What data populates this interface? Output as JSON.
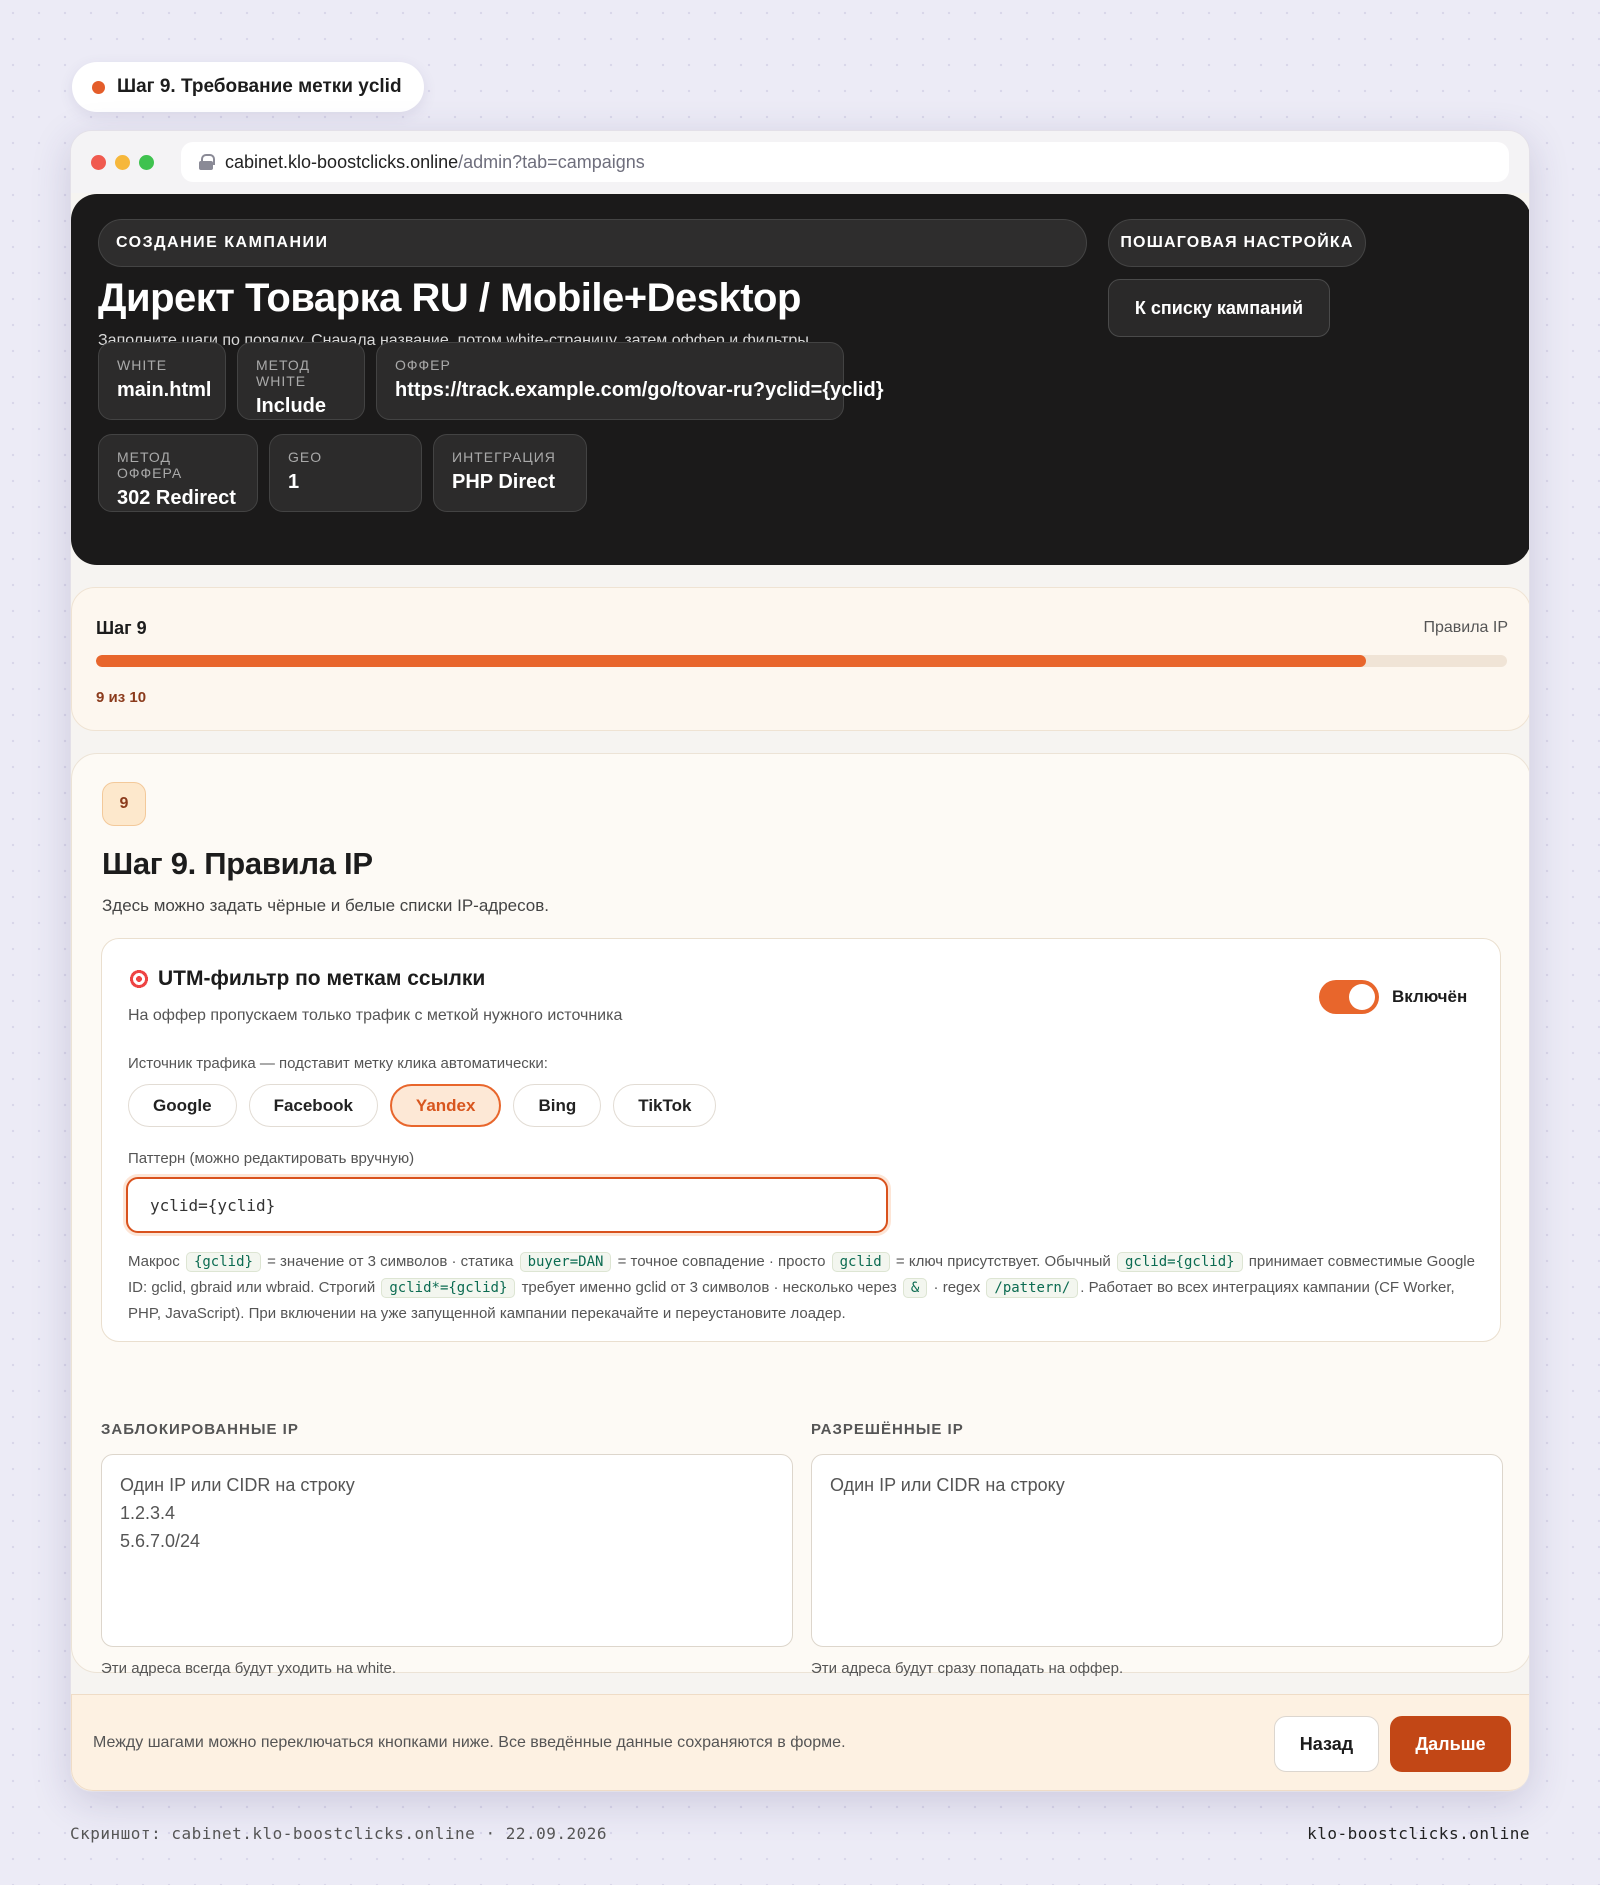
{
  "step_pill": "Шаг 9. Требование метки yclid",
  "browser": {
    "domain": "cabinet.klo-boostclicks.online",
    "path": "/admin?tab=campaigns"
  },
  "hero": {
    "badge": "СОЗДАНИЕ КАМПАНИИ",
    "title": "Директ Товарка RU / Mobile+Desktop",
    "subtitle": "Заполните шаги по порядку. Сначала название, потом white-страницу, затем оффер и фильтры.",
    "right_badge": "ПОШАГОВАЯ НАСТРОЙКА",
    "back_to_list": "К списку кампаний",
    "chips": [
      {
        "key": "WHITE",
        "value": "main.html"
      },
      {
        "key": "МЕТОД WHITE",
        "value": "Include"
      },
      {
        "key": "ОФФЕР",
        "value": "https://track.example.com/go/tovar-ru?yclid={yclid}"
      },
      {
        "key": "МЕТОД ОФФЕРА",
        "value": "302 Redirect"
      },
      {
        "key": "GEO",
        "value": "1"
      },
      {
        "key": "ИНТЕГРАЦИЯ",
        "value": "PHP Direct"
      }
    ]
  },
  "progress": {
    "title": "Шаг 9",
    "right": "Правила IP",
    "counter": "9 из 10",
    "fraction": 0.9
  },
  "step": {
    "number": "9",
    "title": "Шаг 9. Правила IP",
    "description": "Здесь можно задать чёрные и белые списки IP-адресов."
  },
  "utm": {
    "title": "UTM-фильтр по меткам ссылки",
    "subtitle": "На оффер пропускаем только трафик с меткой нужного источника",
    "toggle_label": "Включён",
    "toggle_on": true,
    "source_label": "Источник трафика — подставит метку клика автоматически:",
    "sources": [
      "Google",
      "Facebook",
      "Yandex",
      "Bing",
      "TikTok"
    ],
    "selected_source": "Yandex",
    "pattern_label": "Паттерн (можно редактировать вручную)",
    "pattern_value": "yclid={yclid}",
    "help": {
      "t1": "Макрос",
      "c1": "{gclid}",
      "t2": "= значение от 3 символов · статика",
      "c2": "buyer=DAN",
      "t3": "= точное совпадение · просто",
      "c3": "gclid",
      "t4": "= ключ присутствует. Обычный",
      "c4": "gclid={gclid}",
      "t5": "принимает совместимые Google ID: gclid, gbraid или wbraid. Строгий",
      "c5": "gclid*={gclid}",
      "t6": "требует именно gclid от 3 символов · несколько через",
      "c6": "&",
      "t7": "· regex",
      "c7": "/pattern/",
      "t8": ". Работает во всех интеграциях кампании (CF Worker, PHP, JavaScript). При включении на уже запущенной кампании перекачайте и переустановите лоадер."
    }
  },
  "ip": {
    "blocked_label": "ЗАБЛОКИРОВАННЫЕ IP",
    "blocked_placeholder": "Один IP или CIDR на строку\n1.2.3.4\n5.6.7.0/24",
    "blocked_hint": "Эти адреса всегда будут уходить на white.",
    "allowed_label": "РАЗРЕШЁННЫЕ IP",
    "allowed_placeholder": "Один IP или CIDR на строку",
    "allowed_hint": "Эти адреса будут сразу попадать на оффер."
  },
  "footer": {
    "message": "Между шагами можно переключаться кнопками ниже. Все введённые данные сохраняются в форме.",
    "back": "Назад",
    "next": "Дальше"
  },
  "caption": {
    "left": "Скриншот: cabinet.klo-boostclicks.online · 22.09.2026",
    "right": "klo-boostclicks.online"
  },
  "colors": {
    "accent": "#e8662c",
    "next_button": "#c24716",
    "header_bg": "#1b1a1a"
  }
}
